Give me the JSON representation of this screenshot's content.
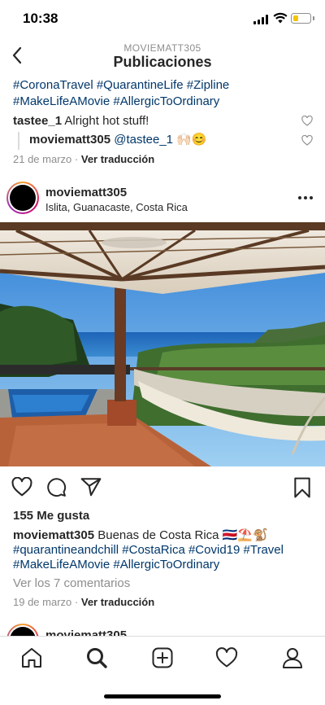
{
  "status_bar": {
    "time": "10:38",
    "battery_level": 0.3
  },
  "header": {
    "username": "MOVIEMATT305",
    "title": "Publicaciones"
  },
  "prev_post": {
    "hashtags_line1": "#CoronaTravel #QuarantineLife #Zipline",
    "hashtags_line2": "#MakeLifeAMovie #AllergicToOrdinary",
    "comment": {
      "user": "tastee_1",
      "text": "Alright hot stuff!"
    },
    "reply": {
      "user": "moviematt305",
      "mention": "@tastee_1",
      "emoji": "🙌🏻😊"
    },
    "date": "21 de marzo",
    "separator": "·",
    "translate": "Ver traducción"
  },
  "post": {
    "username": "moviematt305",
    "location": "Islita, Guanacaste, Costa Rica",
    "likes": "155 Me gusta",
    "caption_user": "moviematt305",
    "caption_text": "Buenas de Costa Rica 🇨🇷⛱️🐒",
    "hashtags_line1": "#quarantineandchill #CostaRica #Covid19 #Travel",
    "hashtags_line2": "#MakeLifeAMovie #AllergicToOrdinary",
    "view_comments": "Ver los 7 comentarios",
    "date": "19 de marzo",
    "separator": "·",
    "translate": "Ver traducción"
  },
  "next_post": {
    "username": "moviematt305"
  },
  "icons": {
    "back": "chevron-left-icon",
    "like": "heart-icon",
    "comment": "comment-icon",
    "share": "paper-plane-icon",
    "save": "bookmark-icon",
    "more": "more-dots-icon",
    "tabs": [
      "home-icon",
      "search-icon",
      "new-post-icon",
      "activity-heart-icon",
      "profile-icon"
    ]
  },
  "colors": {
    "hashtag": "#00376b",
    "text": "#262626",
    "muted": "#8e8e8e",
    "story_ring": "#d10869",
    "battery": "#f4c400"
  }
}
